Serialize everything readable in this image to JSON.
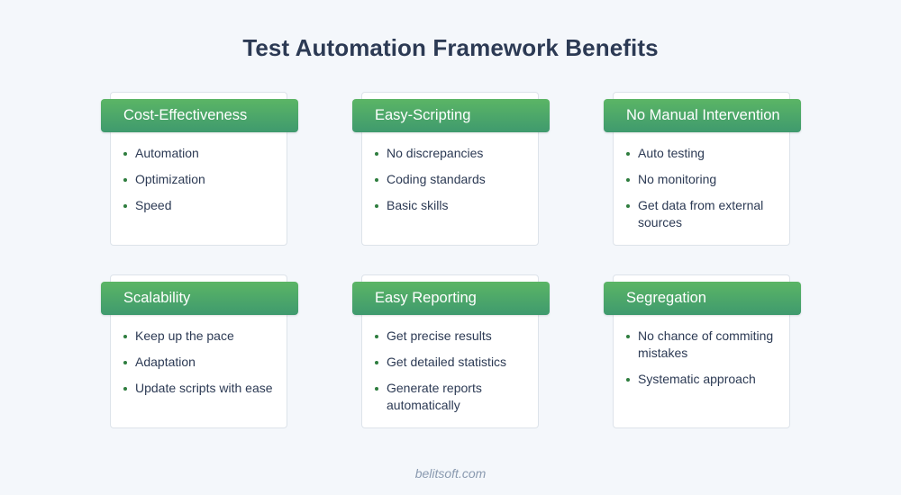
{
  "title": "Test Automation Framework Benefits",
  "colors": {
    "background": "#f4f7fb",
    "header_gradient_top": "#5bb565",
    "header_gradient_bottom": "#3f9a6e",
    "bullet": "#2e7d3e",
    "text": "#2c3a54"
  },
  "cards": [
    {
      "title": "Cost-Effectiveness",
      "items": [
        "Automation",
        "Optimization",
        "Speed"
      ]
    },
    {
      "title": "Easy-Scripting",
      "items": [
        "No discrepancies",
        "Coding standards",
        "Basic skills"
      ]
    },
    {
      "title": "No Manual Intervention",
      "items": [
        "Auto testing",
        "No monitoring",
        "Get data from external sources"
      ]
    },
    {
      "title": "Scalability",
      "items": [
        "Keep up the pace",
        "Adaptation",
        "Update scripts with ease"
      ]
    },
    {
      "title": "Easy Reporting",
      "items": [
        "Get precise results",
        "Get detailed statistics",
        "Generate reports automatically"
      ]
    },
    {
      "title": "Segregation",
      "items": [
        "No chance of commiting mistakes",
        "Systematic approach"
      ]
    }
  ],
  "footer": "belitsoft.com"
}
